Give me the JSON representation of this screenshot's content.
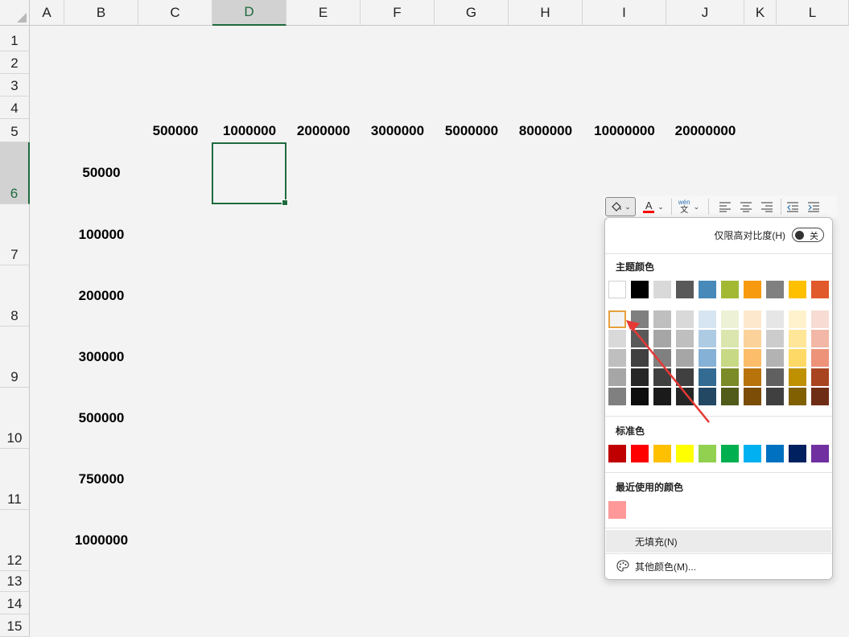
{
  "columns": [
    "A",
    "B",
    "C",
    "D",
    "E",
    "F",
    "G",
    "H",
    "I",
    "J",
    "K",
    "L"
  ],
  "rows": [
    "1",
    "2",
    "3",
    "4",
    "5",
    "6",
    "7",
    "8",
    "9",
    "10",
    "11",
    "12",
    "13",
    "14",
    "15"
  ],
  "selected_column": "D",
  "selected_row": "6",
  "header_row_values": [
    "500000",
    "1000000",
    "2000000",
    "3000000",
    "5000000",
    "8000000",
    "10000000",
    "20000000"
  ],
  "row_labels": [
    "50000",
    "100000",
    "200000",
    "300000",
    "500000",
    "750000",
    "1000000"
  ],
  "mini_toolbar": {
    "fill_icon": "paint-bucket-icon",
    "font_color_letter": "A",
    "font_color": "#ff0000",
    "phonetic_top": "wén",
    "phonetic_bottom": "文"
  },
  "color_panel": {
    "high_contrast_label": "仅限高对比度(H)",
    "toggle_label": "关",
    "theme_colors_title": "主题颜色",
    "theme_top_row": [
      "#ffffff",
      "#000000",
      "#d9d9d9",
      "#595959",
      "#4789b8",
      "#a3b934",
      "#f79a0f",
      "#808080",
      "#ffc000",
      "#e05a2b"
    ],
    "theme_shades": [
      [
        "#f2f2f2",
        "#d9d9d9",
        "#bfbfbf",
        "#a6a6a6",
        "#808080"
      ],
      [
        "#7f7f7f",
        "#595959",
        "#404040",
        "#262626",
        "#0d0d0d"
      ],
      [
        "#bfbfbf",
        "#a6a6a6",
        "#808080",
        "#404040",
        "#1a1a1a"
      ],
      [
        "#d9d9d9",
        "#bfbfbf",
        "#a6a6a6",
        "#404040",
        "#262626"
      ],
      [
        "#d6e5f1",
        "#aecbe4",
        "#85b1d6",
        "#336b93",
        "#234864"
      ],
      [
        "#edf2d6",
        "#dae6ad",
        "#c8d985",
        "#7a8b27",
        "#515c1a"
      ],
      [
        "#fde8cd",
        "#fcd29b",
        "#fbbd69",
        "#b8730b",
        "#7b4d07"
      ],
      [
        "#e6e6e6",
        "#cccccc",
        "#b3b3b3",
        "#606060",
        "#404040"
      ],
      [
        "#fff2cc",
        "#ffe699",
        "#ffd966",
        "#bf9000",
        "#806000"
      ],
      [
        "#f8dcd3",
        "#f2b7a6",
        "#ec937a",
        "#a84420",
        "#702d15"
      ]
    ],
    "standard_title": "标准色",
    "standard_colors": [
      "#c00000",
      "#ff0000",
      "#ffc000",
      "#ffff00",
      "#92d050",
      "#00b050",
      "#00b0f0",
      "#0070c0",
      "#002060",
      "#7030a0"
    ],
    "recent_title": "最近使用的颜色",
    "recent_colors": [
      "#ff9999"
    ],
    "no_fill_label": "无填充(N)",
    "more_colors_label": "其他颜色(M)..."
  }
}
